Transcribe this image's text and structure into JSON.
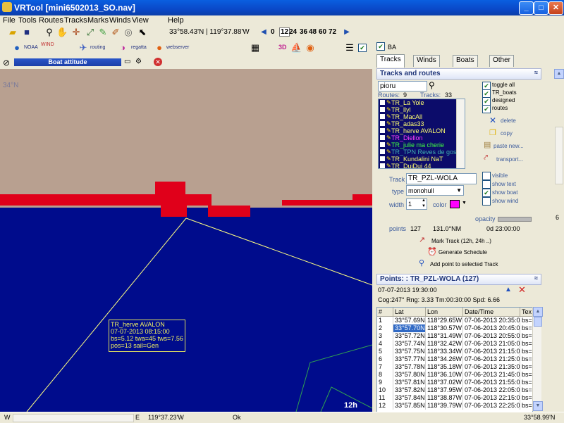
{
  "window": {
    "title": "VRTool [mini6502013_SO.nav]",
    "min": "_",
    "max": "□",
    "close": "✕"
  },
  "menu": [
    "File",
    "Tools",
    "Routes",
    "Tracks",
    "Marks",
    "Winds",
    "View",
    "Help"
  ],
  "toolbar": {
    "coords": "33°58.43'N | 119°37.88'W",
    "zooms": [
      "0",
      "12",
      "24",
      "36",
      "48",
      "60",
      "72"
    ],
    "zoom_selected": "12",
    "prev": "◀",
    "next": "▶"
  },
  "toolbar2": {
    "noaa": "NOAA",
    "wind": "WIND",
    "routing": "routing",
    "regatta": "regatta",
    "webserver": "webserver",
    "three_d": "3D",
    "ba": "BA"
  },
  "boat_bar": {
    "label": "Boat attitude"
  },
  "map": {
    "lat_label": "34°N",
    "time_label": "12h",
    "tooltip": [
      "TR_herve AVALON",
      "07-07-2013 08:15:00",
      "bs=5.12 twa=45 tws=7.56",
      "pos=13 sail=Gen"
    ]
  },
  "tabs": [
    {
      "label": "Tracks",
      "icon": "tracks-icon"
    },
    {
      "label": "Winds",
      "icon": "winds-icon"
    },
    {
      "label": "Boats",
      "icon": "boats-icon"
    },
    {
      "label": "Other",
      "icon": "other-icon"
    }
  ],
  "tracks_panel": {
    "title": "Tracks and routes",
    "search_value": "pioru",
    "routes_label": "Routes:",
    "routes_count": "9",
    "tracks_label": "Tracks:",
    "tracks_count": "33",
    "items": [
      {
        "label": "TR_La Yole",
        "color": "#ffff70"
      },
      {
        "label": "TR_llyl",
        "color": "#ffff70"
      },
      {
        "label": "TR_MacAll",
        "color": "#ffff70"
      },
      {
        "label": "TR_adas33",
        "color": "#ffff70"
      },
      {
        "label": "TR_herve AVALON",
        "color": "#ffff70"
      },
      {
        "label": "TR_Diellon",
        "color": "#ff40ff"
      },
      {
        "label": "TR_julie ma cherie",
        "color": "#40ff40"
      },
      {
        "label": "TR_TPN Reves de gos",
        "color": "#40b0b0"
      },
      {
        "label": "TR_Kundalini NaT",
        "color": "#ffff70"
      },
      {
        "label": "TR_DuiDui 44",
        "color": "#ffff70"
      }
    ],
    "toggles": [
      {
        "label": "toggle all",
        "checked": true
      },
      {
        "label": "TR_boats",
        "checked": true
      },
      {
        "label": "designed",
        "checked": true
      },
      {
        "label": "routes",
        "checked": true
      }
    ],
    "actions": {
      "delete": "delete",
      "copy": "copy",
      "paste": "paste new...",
      "transport": "transport..."
    }
  },
  "track_props": {
    "track_label": "Track",
    "track_value": "TR_PZL-WOLA",
    "type_label": "type",
    "type_value": "monohull",
    "width_label": "width",
    "width_value": "1",
    "color_label": "color",
    "color_value": "#ff00ff",
    "visible": "visible",
    "show_text": "show text",
    "show_boat": "show boat",
    "show_wind": "show wind",
    "opacity_label": "opacity",
    "points_label": "points",
    "points_value": "127",
    "distance": "131.0°NM",
    "duration": "0d 23:00:00",
    "mark_track": "Mark Track (12h, 24h ..)",
    "gen_schedule": "Generate Schedule",
    "add_point": "Add point to selected Track"
  },
  "points_panel": {
    "title": "Points: : TR_PZL-WOLA (127)",
    "datetime": "07-07-2013 19:30:00",
    "cog_line": "Cog:247° Rng: 3.33 Tm:00:30:00 Spd: 6.66",
    "headers": [
      "#",
      "Lat",
      "Lon",
      "Date/Time",
      "Tex"
    ],
    "rows": [
      [
        "1",
        "33°57.69N",
        "118°29.65W",
        "07-06-2013 20:35:00",
        "bs="
      ],
      [
        "2",
        "33°57.70N",
        "118°30.57W",
        "07-06-2013 20:45:00",
        "bs="
      ],
      [
        "3",
        "33°57.72N",
        "118°31.49W",
        "07-06-2013 20:55:00",
        "bs="
      ],
      [
        "4",
        "33°57.74N",
        "118°32.42W",
        "07-06-2013 21:05:00",
        "bs="
      ],
      [
        "5",
        "33°57.75N",
        "118°33.34W",
        "07-06-2013 21:15:00",
        "bs="
      ],
      [
        "6",
        "33°57.77N",
        "118°34.26W",
        "07-06-2013 21:25:00",
        "bs="
      ],
      [
        "7",
        "33°57.78N",
        "118°35.18W",
        "07-06-2013 21:35:00",
        "bs="
      ],
      [
        "8",
        "33°57.80N",
        "118°36.10W",
        "07-06-2013 21:45:00",
        "bs="
      ],
      [
        "9",
        "33°57.81N",
        "118°37.02W",
        "07-06-2013 21:55:00",
        "bs="
      ],
      [
        "10",
        "33°57.82N",
        "118°37.95W",
        "07-06-2013 22:05:00",
        "bs="
      ],
      [
        "11",
        "33°57.84N",
        "118°38.87W",
        "07-06-2013 22:15:00",
        "bs="
      ],
      [
        "12",
        "33°57.85N",
        "118°39.79W",
        "07-06-2013 22:25:00",
        "bs="
      ]
    ]
  },
  "side_num": "6",
  "status": {
    "w": "W",
    "e": "E",
    "lon": "119°37.23'W",
    "ok": "Ok",
    "lat": "33°58.99'N"
  }
}
